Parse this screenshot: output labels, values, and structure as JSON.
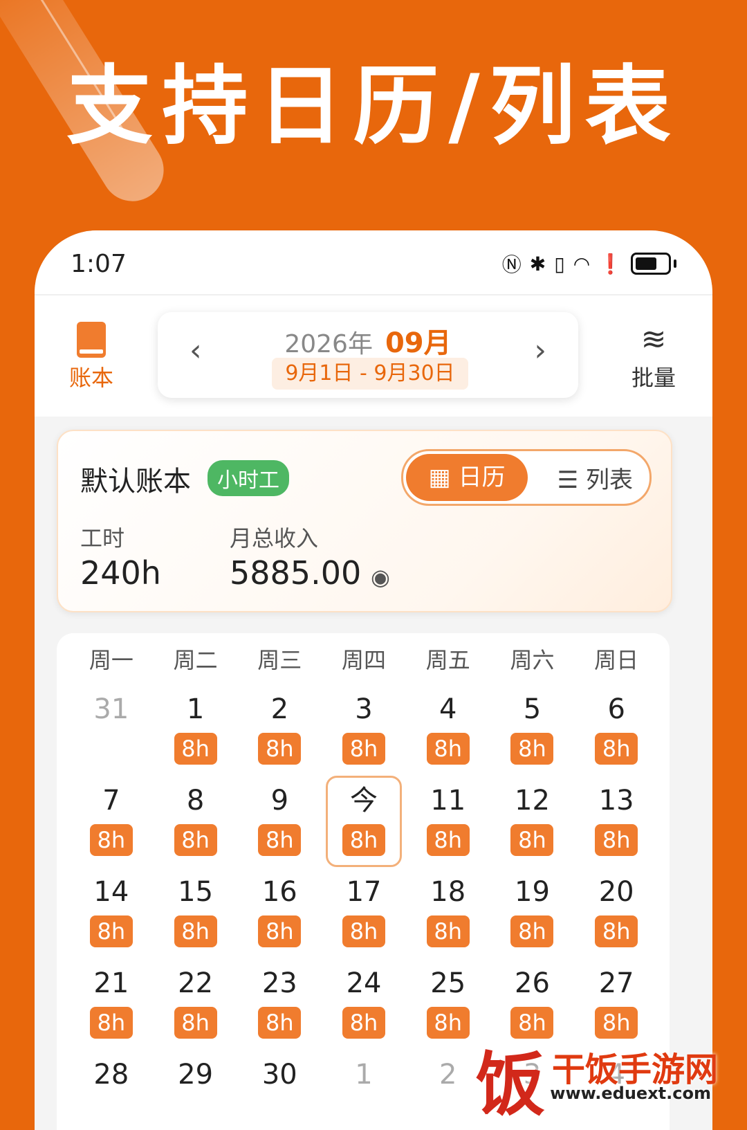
{
  "headline": "支持日历/列表",
  "status": {
    "time": "1:07",
    "icons": [
      "nfc-icon",
      "bluetooth-icon",
      "vibrate-icon",
      "wifi-icon",
      "alert-icon",
      "battery-icon"
    ]
  },
  "nav": {
    "ledger_label": "账本",
    "prev_label": "‹",
    "next_label": "›",
    "year": "2026年",
    "month": "09月",
    "range": "9月1日 - 9月30日",
    "batch_label": "批量"
  },
  "summary": {
    "book_name": "默认账本",
    "tag": "小时工",
    "view_calendar": "日历",
    "view_list": "列表",
    "hours_label": "工时",
    "hours_value": "240h",
    "income_label": "月总收入",
    "income_value": "5885.00"
  },
  "calendar": {
    "weekdays": [
      "周一",
      "周二",
      "周三",
      "周四",
      "周五",
      "周六",
      "周日"
    ],
    "weeks": [
      [
        {
          "d": "31",
          "other": true,
          "h": ""
        },
        {
          "d": "1",
          "h": "8h"
        },
        {
          "d": "2",
          "h": "8h"
        },
        {
          "d": "3",
          "h": "8h"
        },
        {
          "d": "4",
          "h": "8h"
        },
        {
          "d": "5",
          "h": "8h"
        },
        {
          "d": "6",
          "h": "8h"
        }
      ],
      [
        {
          "d": "7",
          "h": "8h"
        },
        {
          "d": "8",
          "h": "8h"
        },
        {
          "d": "9",
          "h": "8h"
        },
        {
          "d": "今",
          "h": "8h",
          "today": true
        },
        {
          "d": "11",
          "h": "8h"
        },
        {
          "d": "12",
          "h": "8h"
        },
        {
          "d": "13",
          "h": "8h"
        }
      ],
      [
        {
          "d": "14",
          "h": "8h"
        },
        {
          "d": "15",
          "h": "8h"
        },
        {
          "d": "16",
          "h": "8h"
        },
        {
          "d": "17",
          "h": "8h"
        },
        {
          "d": "18",
          "h": "8h"
        },
        {
          "d": "19",
          "h": "8h"
        },
        {
          "d": "20",
          "h": "8h"
        }
      ],
      [
        {
          "d": "21",
          "h": "8h"
        },
        {
          "d": "22",
          "h": "8h"
        },
        {
          "d": "23",
          "h": "8h"
        },
        {
          "d": "24",
          "h": "8h"
        },
        {
          "d": "25",
          "h": "8h"
        },
        {
          "d": "26",
          "h": "8h"
        },
        {
          "d": "27",
          "h": "8h"
        }
      ],
      [
        {
          "d": "28",
          "h": ""
        },
        {
          "d": "29",
          "h": ""
        },
        {
          "d": "30",
          "h": ""
        },
        {
          "d": "1",
          "other": true,
          "h": ""
        },
        {
          "d": "2",
          "other": true,
          "h": ""
        },
        {
          "d": "3",
          "other": true,
          "h": ""
        },
        {
          "d": "4",
          "other": true,
          "h": ""
        }
      ]
    ]
  },
  "watermark": {
    "name": "干饭手游网",
    "url": "www.eduext.com",
    "logo_char": "饭"
  }
}
